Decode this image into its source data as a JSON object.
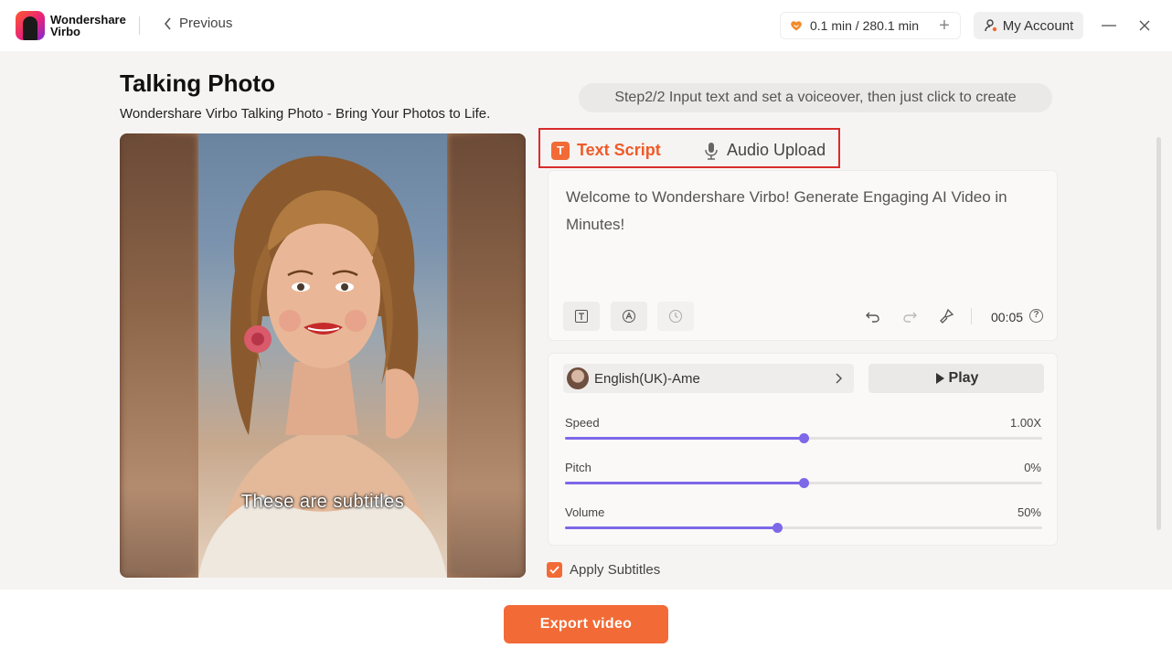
{
  "app": {
    "brand_line1": "Wondershare",
    "brand_line2": "Virbo"
  },
  "nav": {
    "previous_label": "Previous"
  },
  "header": {
    "credits": "0.1 min / 280.1 min",
    "account_label": "My Account"
  },
  "page": {
    "title": "Talking Photo",
    "subtitle": "Wondershare Virbo Talking Photo - Bring Your Photos to Life.",
    "step_hint": "Step2/2 Input text and set a voiceover, then just click to create"
  },
  "photo": {
    "subtitle_preview": "These are subtitles"
  },
  "tabs": [
    {
      "label": "Text Script",
      "icon": "text-t-icon",
      "active": true
    },
    {
      "label": "Audio Upload",
      "icon": "microphone-icon",
      "active": false
    }
  ],
  "script": {
    "text": "Welcome to Wondershare Virbo! Generate Engaging AI Video in Minutes!",
    "duration": "00:05"
  },
  "voice": {
    "name": "English(UK)-Ame",
    "play_label": "Play"
  },
  "sliders": [
    {
      "label": "Speed",
      "value_text": "1.00X",
      "level": 0.5
    },
    {
      "label": "Pitch",
      "value_text": "0%",
      "level": 0.5
    },
    {
      "label": "Volume",
      "value_text": "50%",
      "level": 0.445
    }
  ],
  "options": {
    "apply_subtitles_label": "Apply Subtitles",
    "apply_subtitles_checked": true
  },
  "footer": {
    "export_label": "Export video"
  },
  "colors": {
    "accent": "#f26a36",
    "slider": "#7d68e8",
    "highlight_border": "#d92b2b"
  }
}
